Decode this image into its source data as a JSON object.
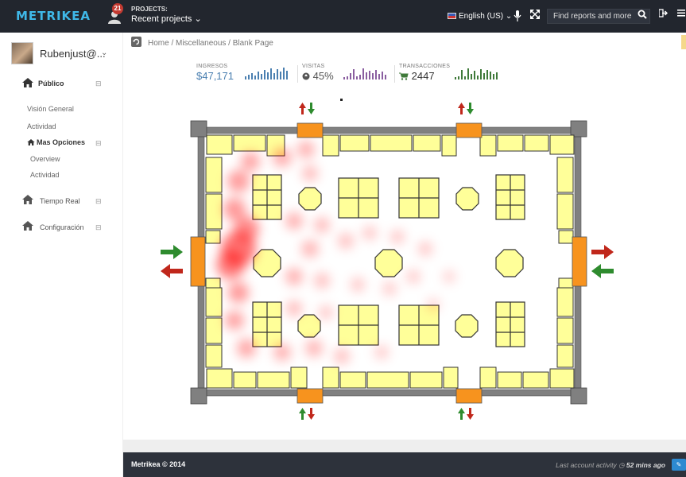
{
  "header": {
    "logo": "METRIKEA",
    "notification_count": "21",
    "projects_label": "PROJECTS:",
    "projects_value": "Recent projects ⌄",
    "language": "English (US) ⌄",
    "search_placeholder": "Find reports and more"
  },
  "sidebar": {
    "username": "Rubenjust@...",
    "username_caret": "⌄",
    "items": [
      {
        "label": "Público",
        "toggle": "⊟"
      },
      {
        "label": "Visión General"
      },
      {
        "label": "Actividad"
      },
      {
        "label": "Mas Opciones",
        "toggle": "⊟"
      },
      {
        "label": "Overview"
      },
      {
        "label": "Actividad"
      },
      {
        "label": "Tiempo Real",
        "toggle": "⊟"
      },
      {
        "label": "Configuración",
        "toggle": "⊟"
      }
    ]
  },
  "breadcrumb": {
    "text": "Home  /  Miscellaneous  /  Blank Page"
  },
  "stats": [
    {
      "label": "INGRESOS",
      "value": "$47,171",
      "color": "#4a7fb0"
    },
    {
      "label": "VISITAS",
      "value": "45%",
      "color": "#8a5ea0"
    },
    {
      "label": "TRANSACCIONES",
      "value": "2447",
      "color": "#3f7a3a"
    }
  ],
  "footer": {
    "copyright": "Metrikea © 2014",
    "activity_label": "Last account activity",
    "activity_value": "52 mins ago"
  },
  "colors": {
    "topbar": "#22262e",
    "footer": "#2d323b",
    "shelf": "#ffff99",
    "wall": "#808080",
    "door": "#f7931e",
    "heat": "#ff0000",
    "arrow_red": "#c0271b",
    "arrow_green": "#2e8b2e"
  },
  "icons": [
    "notification-icon",
    "mic-icon",
    "expand-icon",
    "search-icon",
    "logout-icon",
    "menu-icon",
    "home-icon",
    "refresh-icon",
    "globe-icon",
    "cart-icon",
    "clock-icon"
  ]
}
